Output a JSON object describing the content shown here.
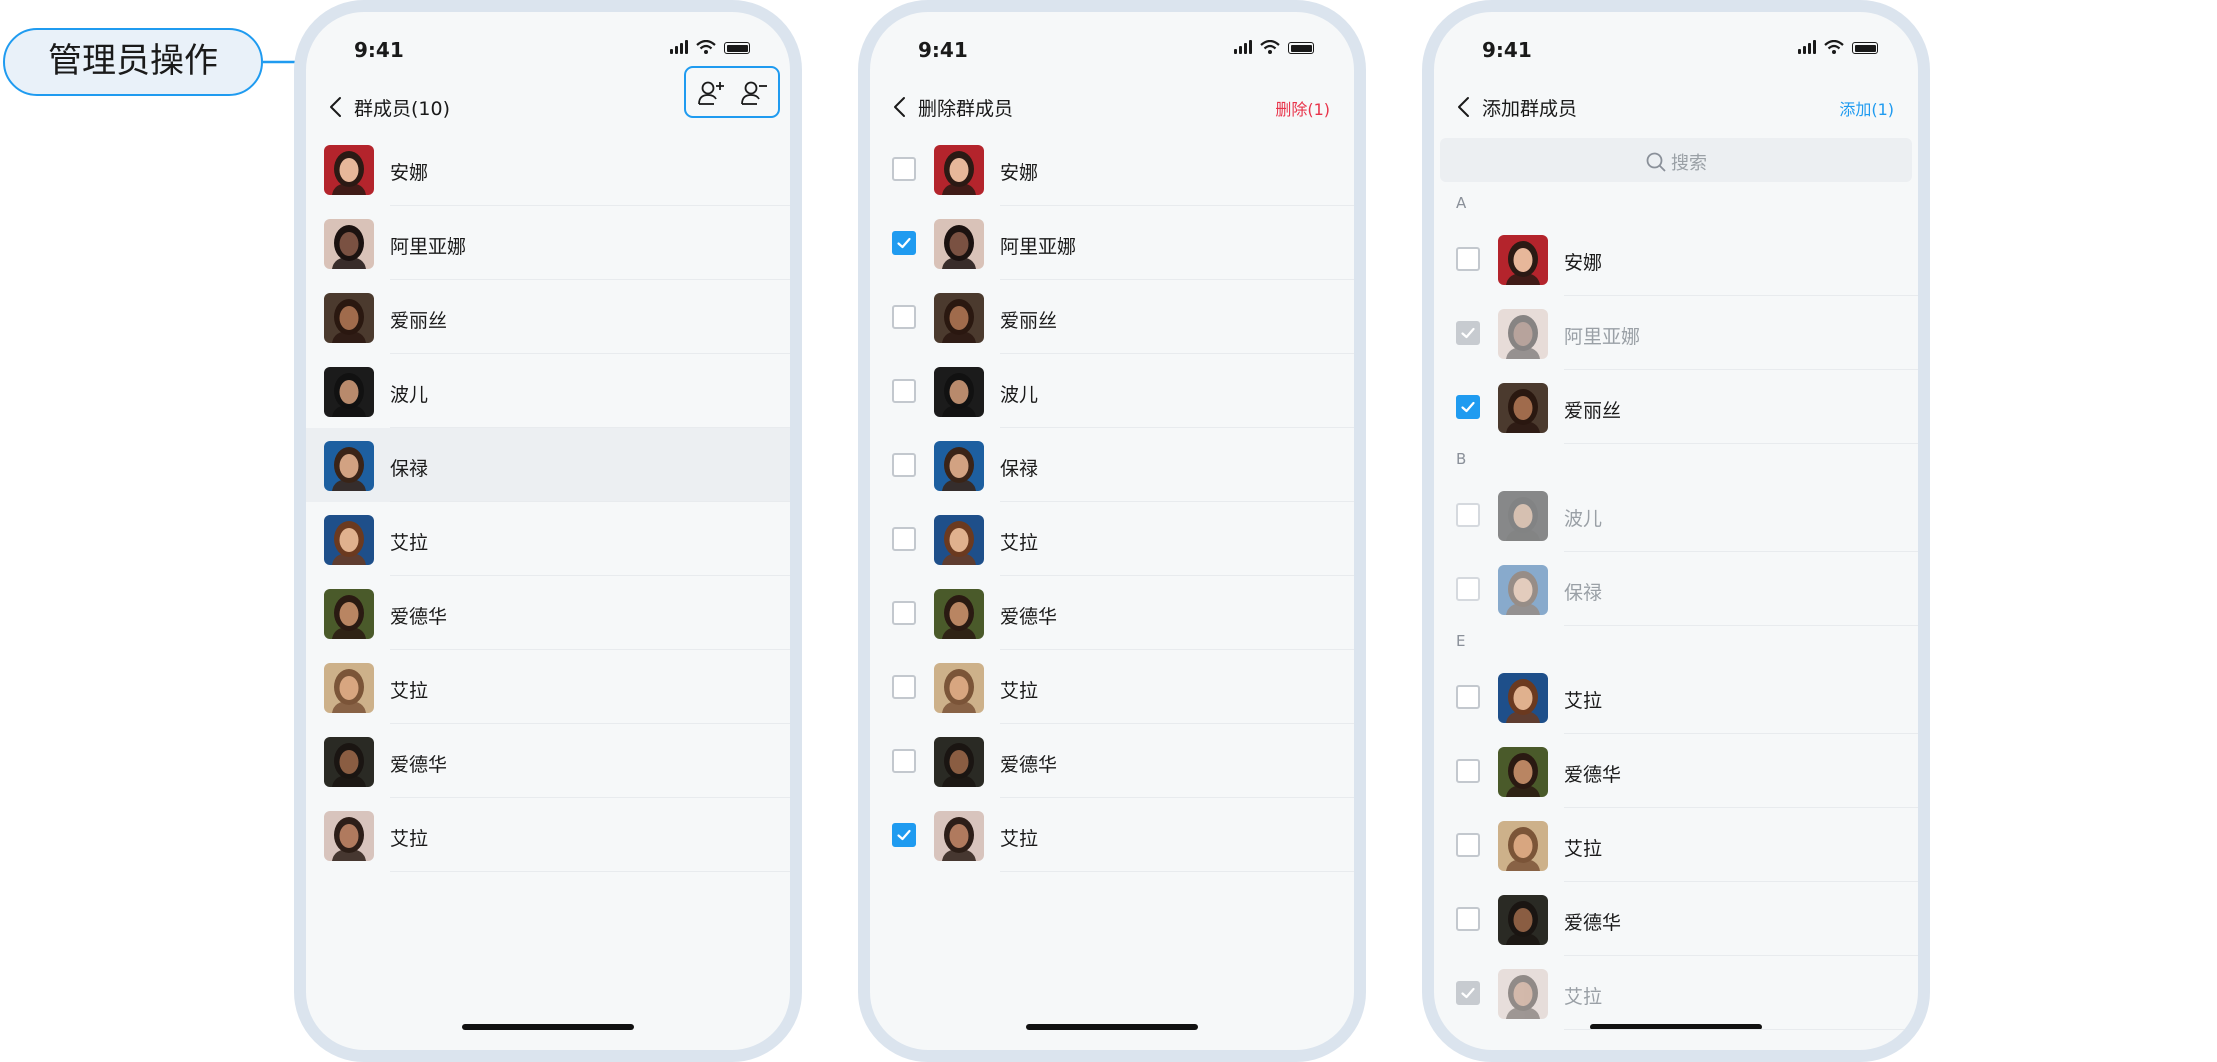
{
  "annotation": {
    "label": "管理员操作"
  },
  "colors": {
    "accent": "#1f9bf0",
    "delete": "#e8334a",
    "frame": "#dbe4ee"
  },
  "status_time": "9:41",
  "screen1": {
    "title": "群成员(10)",
    "actions": [
      {
        "icon": "add-member-icon"
      },
      {
        "icon": "remove-member-icon"
      }
    ],
    "members": [
      {
        "name": "安娜",
        "avatar_bg": "#b4242c",
        "skin": "#e7b79a",
        "hair": "#2b1a14"
      },
      {
        "name": "阿里亚娜",
        "avatar_bg": "#d9c2b8",
        "skin": "#7a5142",
        "hair": "#1b1210"
      },
      {
        "name": "爱丽丝",
        "avatar_bg": "#4b3a2e",
        "skin": "#a06b4c",
        "hair": "#2a1810"
      },
      {
        "name": "波儿",
        "avatar_bg": "#1b1b1b",
        "skin": "#b88a6c",
        "hair": "#111111"
      },
      {
        "name": "保禄",
        "avatar_bg": "#1d5fa0",
        "skin": "#d2a282",
        "hair": "#3a2418",
        "highlight": true
      },
      {
        "name": "艾拉",
        "avatar_bg": "#1e4f8a",
        "skin": "#e0b18e",
        "hair": "#6b3a20"
      },
      {
        "name": "爱德华",
        "avatar_bg": "#4a5a2a",
        "skin": "#b98562",
        "hair": "#2a1a12"
      },
      {
        "name": "艾拉",
        "avatar_bg": "#cdb18a",
        "skin": "#d8a680",
        "hair": "#7b5538"
      },
      {
        "name": "爱德华",
        "avatar_bg": "#2a2a24",
        "skin": "#8a5d42",
        "hair": "#1a1512"
      },
      {
        "name": "艾拉",
        "avatar_bg": "#d8c4bd",
        "skin": "#b07a5e",
        "hair": "#2d1e18"
      }
    ]
  },
  "screen2": {
    "title": "删除群成员",
    "action": "删除(1)",
    "members": [
      {
        "name": "安娜",
        "checked": false,
        "avatar_bg": "#b4242c",
        "skin": "#e7b79a",
        "hair": "#2b1a14"
      },
      {
        "name": "阿里亚娜",
        "checked": true,
        "avatar_bg": "#d9c2b8",
        "skin": "#7a5142",
        "hair": "#1b1210"
      },
      {
        "name": "爱丽丝",
        "checked": false,
        "avatar_bg": "#4b3a2e",
        "skin": "#a06b4c",
        "hair": "#2a1810"
      },
      {
        "name": "波儿",
        "checked": false,
        "avatar_bg": "#1b1b1b",
        "skin": "#b88a6c",
        "hair": "#111111"
      },
      {
        "name": "保禄",
        "checked": false,
        "avatar_bg": "#1d5fa0",
        "skin": "#d2a282",
        "hair": "#3a2418"
      },
      {
        "name": "艾拉",
        "checked": false,
        "avatar_bg": "#1e4f8a",
        "skin": "#e0b18e",
        "hair": "#6b3a20"
      },
      {
        "name": "爱德华",
        "checked": false,
        "avatar_bg": "#4a5a2a",
        "skin": "#b98562",
        "hair": "#2a1a12"
      },
      {
        "name": "艾拉",
        "checked": false,
        "avatar_bg": "#cdb18a",
        "skin": "#d8a680",
        "hair": "#7b5538"
      },
      {
        "name": "爱德华",
        "checked": false,
        "avatar_bg": "#2a2a24",
        "skin": "#8a5d42",
        "hair": "#1a1512"
      },
      {
        "name": "艾拉",
        "checked": true,
        "avatar_bg": "#d8c4bd",
        "skin": "#b07a5e",
        "hair": "#2d1e18"
      }
    ]
  },
  "screen3": {
    "title": "添加群成员",
    "action": "添加(1)",
    "search_placeholder": "搜索",
    "sections": [
      {
        "letter": "A",
        "items": [
          {
            "name": "安娜",
            "state": "unchecked",
            "avatar_bg": "#b4242c",
            "skin": "#e7b79a",
            "hair": "#2b1a14"
          },
          {
            "name": "阿里亚娜",
            "state": "existing",
            "avatar_bg": "#d9c2b8",
            "skin": "#7a5142",
            "hair": "#1b1210"
          },
          {
            "name": "爱丽丝",
            "state": "checked",
            "avatar_bg": "#4b3a2e",
            "skin": "#a06b4c",
            "hair": "#2a1810"
          }
        ]
      },
      {
        "letter": "B",
        "items": [
          {
            "name": "波儿",
            "state": "disabled",
            "avatar_bg": "#1b1b1b",
            "skin": "#b88a6c",
            "hair": "#111111"
          },
          {
            "name": "保禄",
            "state": "disabled",
            "avatar_bg": "#1d5fa0",
            "skin": "#d2a282",
            "hair": "#3a2418"
          }
        ]
      },
      {
        "letter": "E",
        "items": [
          {
            "name": "艾拉",
            "state": "unchecked",
            "avatar_bg": "#1e4f8a",
            "skin": "#e0b18e",
            "hair": "#6b3a20"
          },
          {
            "name": "爱德华",
            "state": "unchecked",
            "avatar_bg": "#4a5a2a",
            "skin": "#b98562",
            "hair": "#2a1a12"
          },
          {
            "name": "艾拉",
            "state": "unchecked",
            "avatar_bg": "#cdb18a",
            "skin": "#d8a680",
            "hair": "#7b5538"
          },
          {
            "name": "爱德华",
            "state": "unchecked",
            "avatar_bg": "#2a2a24",
            "skin": "#8a5d42",
            "hair": "#1a1512"
          },
          {
            "name": "艾拉",
            "state": "existing",
            "avatar_bg": "#d8c4bd",
            "skin": "#b07a5e",
            "hair": "#2d1e18"
          }
        ]
      }
    ]
  }
}
